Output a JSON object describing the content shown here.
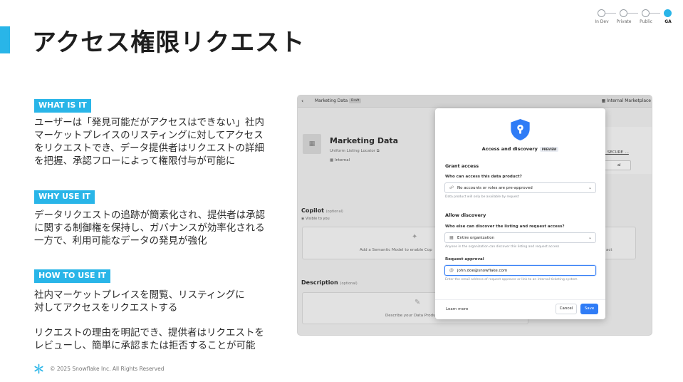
{
  "title": "アクセス権限リクエスト",
  "stages": {
    "items": [
      "In Dev",
      "Private",
      "Public",
      "GA"
    ],
    "active_index": 3,
    "active_color": "#29b5e8"
  },
  "sections": [
    {
      "badge": "WHAT IS IT",
      "text": "ユーザーは「発見可能だがアクセスはできない」社内\nマーケットプレイスのリスティングに対してアクセス\nをリクエストでき、データ提供者はリクエストの詳細\nを把握、承認フローによって権限付与が可能に"
    },
    {
      "badge": "WHY USE IT",
      "text": "データリクエストの追跡が簡素化され、提供者は承認\nに関する制御権を保持し、ガバナンスが効率化される\n一方で、利用可能なデータの発見が強化"
    },
    {
      "badge": "HOW TO USE IT",
      "text": "社内マーケットプレイスを閲覧、リスティングに\n対してアクセスをリクエストする",
      "text2": "リクエストの理由を明記でき、提供者はリクエストを\nレビューし、簡単に承認または拒否することが可能"
    }
  ],
  "footer": {
    "copyright": "© 2025 Snowflake Inc. All Rights Reserved",
    "logo_icon": "snowflake-icon"
  },
  "screenshot": {
    "topbar": {
      "back_icon": "chevron-left-icon",
      "name": "Marketing Data",
      "badge": "Draft",
      "right": "Internal Marketplace"
    },
    "product": {
      "title": "Marketing Data",
      "sub": "Uniform Listing Locator",
      "internal": "Internal"
    },
    "card": {
      "text": "_SECURE_...",
      "button": "al"
    },
    "copilot": {
      "title": "Copilot",
      "optional": "(optional)",
      "visible": "Visible to you",
      "box_text": "Add a Semantic Model to enable Cop",
      "box_right": "act"
    },
    "description": {
      "title": "Description",
      "optional": "(optional)",
      "box_text": "Describe your Data Produ"
    },
    "modal": {
      "title": "Access and discovery",
      "preview": "PREVIEW",
      "grant_access": "Grant access",
      "who_access_q": "Who can access this data product?",
      "access_value": "No accounts or roles are pre-approved",
      "access_help": "Data product will only be available by request",
      "allow_discovery": "Allow discovery",
      "who_discover_q": "Who else can discover the listing and request access?",
      "discover_value": "Entire organization",
      "discover_help": "Anyone in the organization can discover this listing and request access",
      "request_approval": "Request approval",
      "approver_value": "john.doe@snowflake.com",
      "approver_help": "Enter the email address of request approver or link to an internal ticketing system",
      "learn_more": "Learn more",
      "cancel": "Cancel",
      "save": "Save"
    }
  }
}
